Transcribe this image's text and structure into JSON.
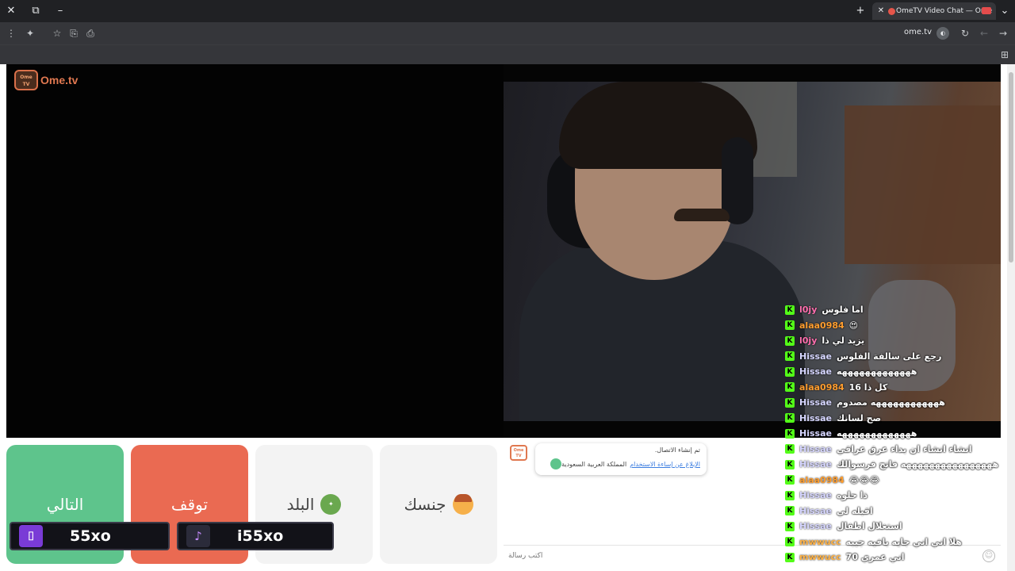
{
  "browser": {
    "tab_title": "OmeTV Video Chat — Ome",
    "url": "ome.tv"
  },
  "logo": {
    "badge": "Ome TV",
    "text": "Ome.tv"
  },
  "controls": {
    "next_label": "التالي",
    "stop_label": "توقف",
    "country_label": "البلد",
    "gender_label": "جنسك"
  },
  "social": {
    "twitch_handle": "55xo",
    "tiktok_handle": "i55xo"
  },
  "system_message": {
    "line1": "تم إنشاء الاتصال.",
    "report_link": "الإبلاغ عن إساءة الاستخدام",
    "country": "المملكة العربية السعودية"
  },
  "chat_input": {
    "placeholder": "اكتب رسالة"
  },
  "chat_overlay": [
    {
      "user": "l0jy",
      "msg": "اما فلوس",
      "color": "#ff6fae"
    },
    {
      "user": "alaa0984",
      "msg": "😍",
      "color": "#ff9d2e"
    },
    {
      "user": "l0jy",
      "msg": "يزيد لي ذا",
      "color": "#ff6fae"
    },
    {
      "user": "Hissae",
      "msg": "رجع على سالفة الفلوس",
      "color": "#d6d6ff"
    },
    {
      "user": "Hissae",
      "msg": "هههههههههههههه",
      "color": "#d6d6ff"
    },
    {
      "user": "alaa0984",
      "msg": "كل ذا 16",
      "color": "#ff9d2e"
    },
    {
      "user": "Hissae",
      "msg": "ههههههههههههه مصدوم",
      "color": "#d6d6ff"
    },
    {
      "user": "Hissae",
      "msg": "صح لسانك",
      "color": "#d6d6ff"
    },
    {
      "user": "Hissae",
      "msg": "هههههههههههههه",
      "color": "#d6d6ff"
    },
    {
      "user": "Hissae",
      "msg": "انشاء انشاء ان بداء عرق عراقي",
      "color": "#d6d6ff"
    },
    {
      "user": "Hissae",
      "msg": "ههههههههههههههههه فاتح فرسوالك",
      "color": "#d6d6ff"
    },
    {
      "user": "alaa0984",
      "msg": "😂😂😂",
      "color": "#ff9d2e"
    },
    {
      "user": "Hissae",
      "msg": "ذا حلوه",
      "color": "#d6d6ff"
    },
    {
      "user": "Hissae",
      "msg": "اقبله لي",
      "color": "#d6d6ff"
    },
    {
      "user": "Hissae",
      "msg": "استغلال اطفال",
      "color": "#d6d6ff"
    },
    {
      "user": "mwwucc",
      "msg": "هلا اني اني جايه بافيه جيبه",
      "color": "#ffb347"
    },
    {
      "user": "mwwucc",
      "msg": "اني عمري 70",
      "color": "#ffb347"
    }
  ]
}
